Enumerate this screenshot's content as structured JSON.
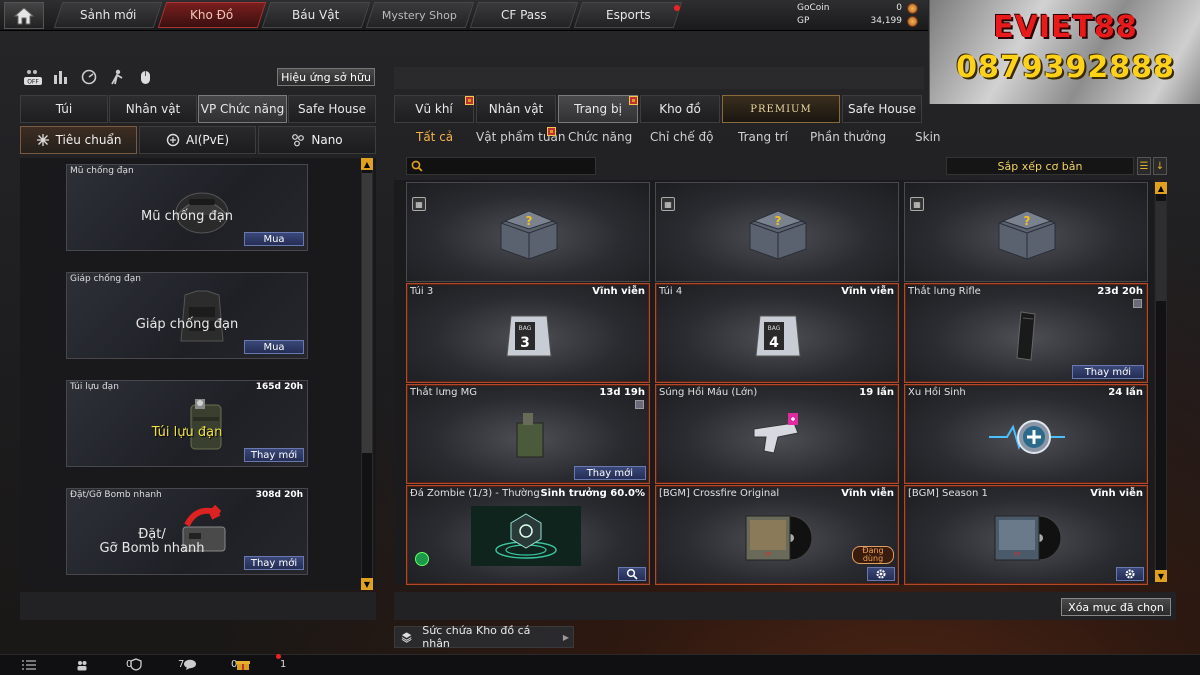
{
  "topnav": {
    "tabs": [
      {
        "label": "Sảnh mới",
        "active": false
      },
      {
        "label": "Kho Đồ",
        "active": true
      },
      {
        "label": "Báu Vật",
        "active": false
      },
      {
        "label": "Mystery Shop",
        "active": false
      },
      {
        "label": "CF Pass",
        "active": false
      },
      {
        "label": "Esports",
        "active": false,
        "notification": true
      }
    ]
  },
  "currency": {
    "gocoin_label": "GoCoin",
    "gocoin_value": "0",
    "gp_label": "GP",
    "gp_value": "34,199"
  },
  "watermark": {
    "line1": "EVIET88",
    "line2": "0879392888"
  },
  "left_panel": {
    "effect_button": "Hiệu ứng sở hữu",
    "toolbar_icons": [
      "off-toggle-icon",
      "bars-icon",
      "gauge-icon",
      "figure-icon",
      "mouse-icon"
    ],
    "off_label": "OFF",
    "tabs": [
      {
        "label": "Túi",
        "active": false
      },
      {
        "label": "Nhân vật",
        "active": false
      },
      {
        "label": "VP Chức năng",
        "active": true
      },
      {
        "label": "Safe House",
        "active": false
      }
    ],
    "subtabs": [
      {
        "label": "Tiêu chuẩn",
        "active": true
      },
      {
        "label": "AI(PvE)",
        "active": false
      },
      {
        "label": "Nano",
        "active": false
      }
    ],
    "items": [
      {
        "name": "Mũ chống đạn",
        "duration": "",
        "art_label": "Mũ chống đạn",
        "action": "Mua",
        "art": "helmet"
      },
      {
        "name": "Giáp chống đạn",
        "duration": "",
        "art_label": "Giáp chống đạn",
        "action": "Mua",
        "art": "armor"
      },
      {
        "name": "Túi lựu đạn",
        "duration": "165d 20h",
        "art_label": "Túi lựu đạn",
        "action": "Thay mới",
        "art": "grenade-pouch"
      },
      {
        "name": "Đặt/Gỡ Bomb nhanh",
        "duration": "308d 20h",
        "art_label_1": "Đặt/",
        "art_label_2": "Gỡ Bomb nhanh",
        "action": "Thay mới",
        "art": "bomb"
      }
    ]
  },
  "right_panel": {
    "tabs": [
      {
        "label": "Vũ khí",
        "active": false,
        "gift": true
      },
      {
        "label": "Nhân vật",
        "active": false
      },
      {
        "label": "Trang bị",
        "active": true,
        "gift": true
      },
      {
        "label": "Kho đồ",
        "active": false
      },
      {
        "label": "PREMIUM",
        "active": false
      },
      {
        "label": "Safe House",
        "active": false
      }
    ],
    "subtabs": [
      {
        "label": "Tất cả",
        "active": true
      },
      {
        "label": "Vật phẩm tuần",
        "active": false,
        "gift": true
      },
      {
        "label": "Chức năng",
        "active": false
      },
      {
        "label": "Chỉ chế độ",
        "active": false
      },
      {
        "label": "Trang trí",
        "active": false
      },
      {
        "label": "Phần thưởng",
        "active": false
      },
      {
        "label": "Skin",
        "active": false
      }
    ],
    "search": {
      "value": "",
      "placeholder": ""
    },
    "sort_label": "Sắp xếp cơ bản",
    "grid": [
      {
        "name": "",
        "duration": "",
        "action": "",
        "art": "crate",
        "clan": true
      },
      {
        "name": "",
        "duration": "",
        "action": "",
        "art": "crate",
        "clan": true
      },
      {
        "name": "",
        "duration": "",
        "action": "",
        "art": "crate",
        "clan": true
      },
      {
        "name": "Túi 3",
        "duration": "Vĩnh viễn",
        "action": "",
        "art": "bag-3",
        "bag_number": "3",
        "bag_label": "BAG"
      },
      {
        "name": "Túi  4",
        "duration": "Vĩnh viễn",
        "action": "",
        "art": "bag-4",
        "bag_number": "4",
        "bag_label": "BAG"
      },
      {
        "name": "Thắt lưng Rifle",
        "duration": "23d 20h",
        "action": "Thay mới",
        "art": "rifle-mag",
        "lock": true
      },
      {
        "name": "Thắt lưng MG",
        "duration": "13d 19h",
        "action": "Thay mới",
        "art": "mg-belt",
        "lock": true
      },
      {
        "name": "Súng Hồi Máu (Lớn)",
        "duration": "19 lần",
        "action": "",
        "art": "heal-gun"
      },
      {
        "name": "Xu Hồi Sinh",
        "duration": "24 lần",
        "action": "",
        "art": "revive-coin"
      },
      {
        "name": "Đá Zombie (1/3) - Thường",
        "duration": "Sinh trưởng 60.0%",
        "action": "search-icon",
        "art": "zombie-stone"
      },
      {
        "name": "[BGM] Crossfire Original",
        "duration": "Vĩnh viễn",
        "action": "gear-icon",
        "art": "bgm-record",
        "badge": "Đang dùng"
      },
      {
        "name": "[BGM] Season 1",
        "duration": "Vĩnh viễn",
        "action": "gear-icon",
        "art": "bgm-record"
      }
    ],
    "delete_button": "Xóa mục đã chọn",
    "capacity_label": "Sức chứa Kho đồ cá nhân"
  },
  "statusbar": {
    "items": [
      {
        "icon": "list-icon",
        "value": ""
      },
      {
        "icon": "friends-icon",
        "value": "0"
      },
      {
        "icon": "clan-shield-icon",
        "value": "7"
      },
      {
        "icon": "chat-icon",
        "value": "0"
      },
      {
        "icon": "gift-box-icon",
        "value": "1"
      }
    ]
  },
  "colors": {
    "accent_orange": "#f5b24a",
    "permanent_border": "#b04a2a",
    "action_blue": "#3a4778",
    "active_tab_red": "#7a1e1e"
  }
}
